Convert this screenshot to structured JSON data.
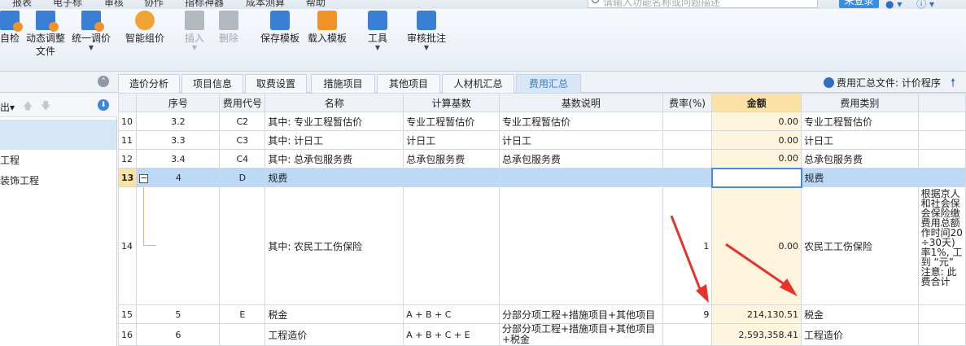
{
  "menu": [
    "报表",
    "电子标",
    "审核",
    "协作",
    "指标神器",
    "成本测算",
    "帮助"
  ],
  "search": {
    "placeholder": "请输入功能名称或问题描述"
  },
  "login_label": "未登录",
  "ribbon": {
    "buttons": [
      {
        "label": "自检",
        "icon": "check-doc-icon"
      },
      {
        "label": "动态调整",
        "label2": "文件",
        "icon": "dynamic-adjust-icon"
      },
      {
        "label": "统一调价",
        "icon": "unified-price-icon"
      },
      {
        "label": "智能组价",
        "icon": "smart-price-icon"
      },
      {
        "label": "插入",
        "icon": "insert-icon"
      },
      {
        "label": "删除",
        "icon": "delete-icon"
      },
      {
        "label": "保存模板",
        "icon": "save-template-icon"
      },
      {
        "label": "载入模板",
        "icon": "load-template-icon"
      },
      {
        "label": "工具",
        "icon": "tools-icon"
      },
      {
        "label": "审核批注",
        "icon": "review-note-icon"
      }
    ]
  },
  "tabs": [
    "造价分析",
    "项目信息",
    "取费设置",
    "措施项目",
    "其他项目",
    "人材机汇总",
    "费用汇总"
  ],
  "summary_file": "费用汇总文件: 计价程序",
  "left_panel": {
    "export_label": "出",
    "items": [
      "工程",
      "装饰工程"
    ]
  },
  "table": {
    "headers": [
      "序号",
      "费用代号",
      "名称",
      "计算基数",
      "基数说明",
      "费率(%)",
      "金额",
      "费用类别"
    ],
    "rows": [
      {
        "rn": "10",
        "seq": "3.2",
        "code": "C2",
        "name": "其中: 专业工程暂估价",
        "base": "专业工程暂估价",
        "desc": "专业工程暂估价",
        "rate": "",
        "amount": "0.00",
        "cat": "专业工程暂估价"
      },
      {
        "rn": "11",
        "seq": "3.3",
        "code": "C3",
        "name": "其中: 计日工",
        "base": "计日工",
        "desc": "计日工",
        "rate": "",
        "amount": "0.00",
        "cat": "计日工"
      },
      {
        "rn": "12",
        "seq": "3.4",
        "code": "C4",
        "name": "其中: 总承包服务费",
        "base": "总承包服务费",
        "desc": "总承包服务费",
        "rate": "",
        "amount": "0.00",
        "cat": "总承包服务费"
      },
      {
        "rn": "13",
        "seq": "4",
        "code": "D",
        "name": "规费",
        "base": "",
        "desc": "",
        "rate": "",
        "amount": "",
        "cat": "规费"
      },
      {
        "rn": "14",
        "seq": "",
        "code": "",
        "name": "其中: 农民工工伤保险",
        "base": "",
        "desc": "",
        "rate": "1",
        "amount": "0.00",
        "cat": "农民工工伤保险",
        "note_lines": [
          "根据京人",
          "和社会保",
          "会保险缴",
          "费用总额",
          "作时间20",
          "÷30天)",
          "率1%, 工",
          "到 “元”",
          "注意: 此",
          "费合计"
        ]
      },
      {
        "rn": "15",
        "seq": "5",
        "code": "E",
        "name": "税金",
        "base": "A + B + C",
        "desc": "分部分项工程+措施项目+其他项目",
        "rate": "9",
        "amount": "214,130.51",
        "cat": "税金"
      },
      {
        "rn": "16",
        "seq": "6",
        "code": "",
        "name": "工程造价",
        "base": "A + B + C + E",
        "desc": "分部分项工程+措施项目+其他项目+税金",
        "rate": "",
        "amount": "2,593,358.41",
        "cat": "工程造价"
      }
    ]
  },
  "colors": {
    "arrow": "#e8312a",
    "accent": "#2f6fbd",
    "money_header": "#f9e2a3"
  }
}
